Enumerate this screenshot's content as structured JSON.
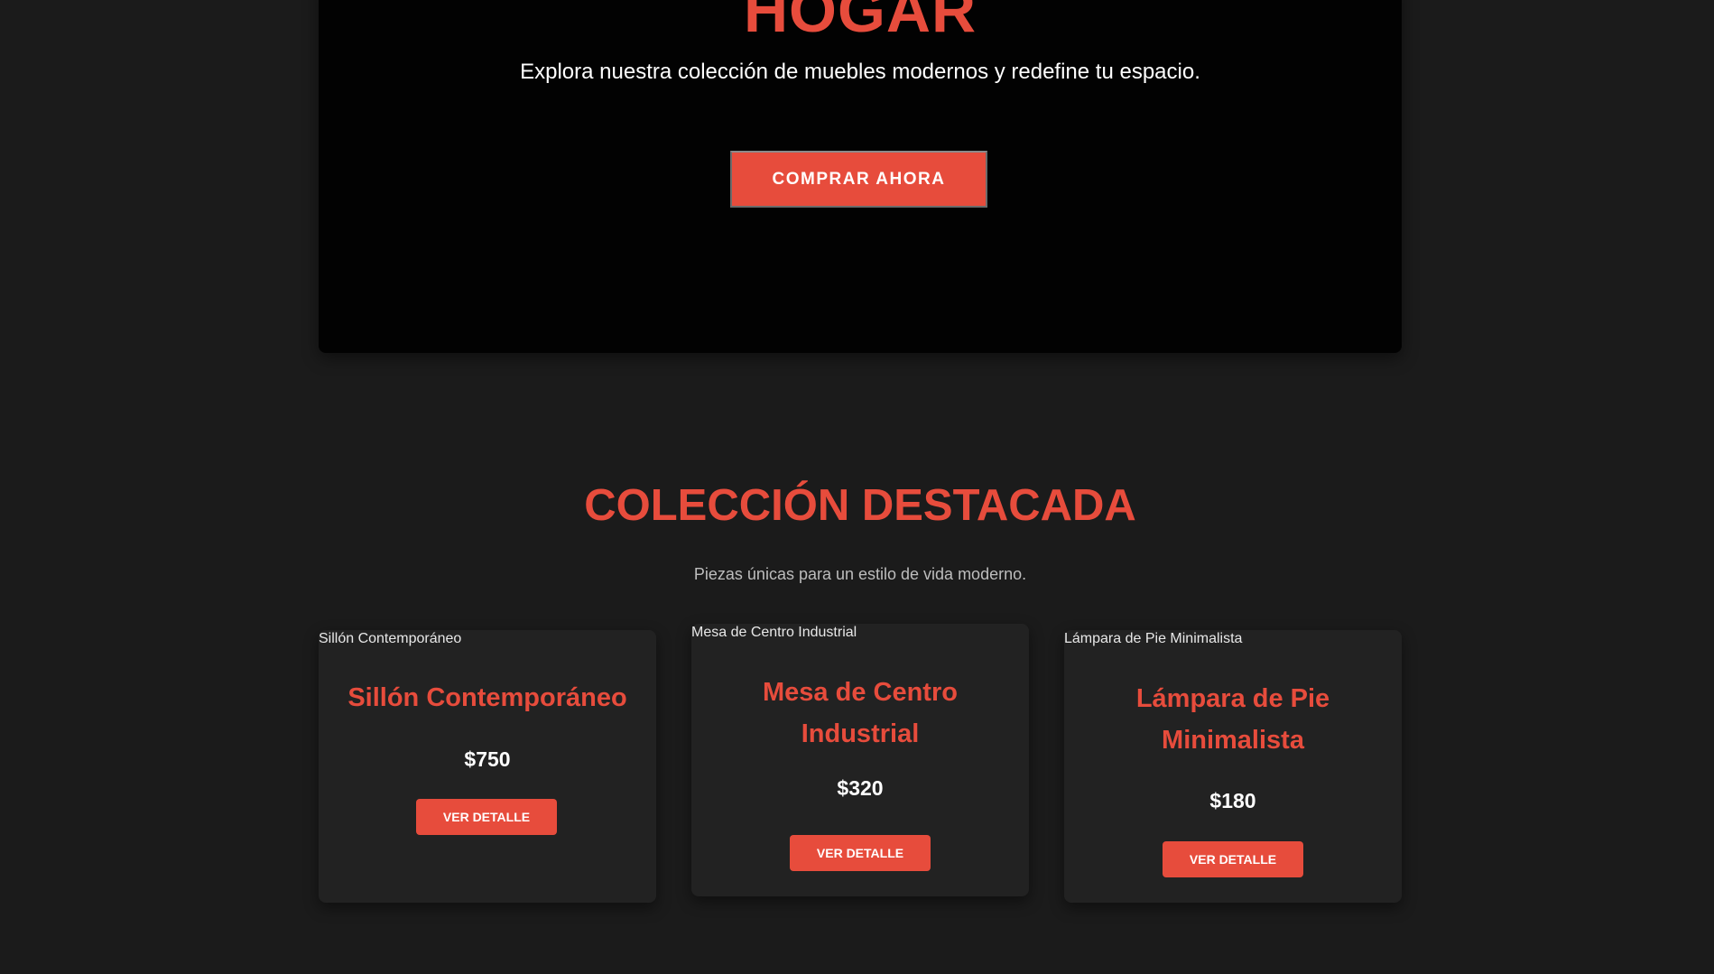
{
  "hero": {
    "title": "HOGAR",
    "subtitle": "Explora nuestra colección de muebles modernos y redefine tu espacio.",
    "cta_label": "COMPRAR AHORA"
  },
  "featured": {
    "title": "COLECCIÓN DESTACADA",
    "subtitle": "Piezas únicas para un estilo de vida moderno.",
    "products": [
      {
        "image_alt": "Sillón Contemporáneo",
        "name": "Sillón Contemporáneo",
        "price": "$750",
        "button_label": "VER DETALLE"
      },
      {
        "image_alt": "Mesa de Centro Industrial",
        "name": "Mesa de Centro Industrial",
        "price": "$320",
        "button_label": "VER DETALLE"
      },
      {
        "image_alt": "Lámpara de Pie Minimalista",
        "name": "Lámpara de Pie Minimalista",
        "price": "$180",
        "button_label": "VER DETALLE"
      }
    ]
  },
  "colors": {
    "accent": "#e74c3c",
    "page_background": "#1b1b1b",
    "hero_background": "#020202",
    "card_background": "#222222"
  }
}
